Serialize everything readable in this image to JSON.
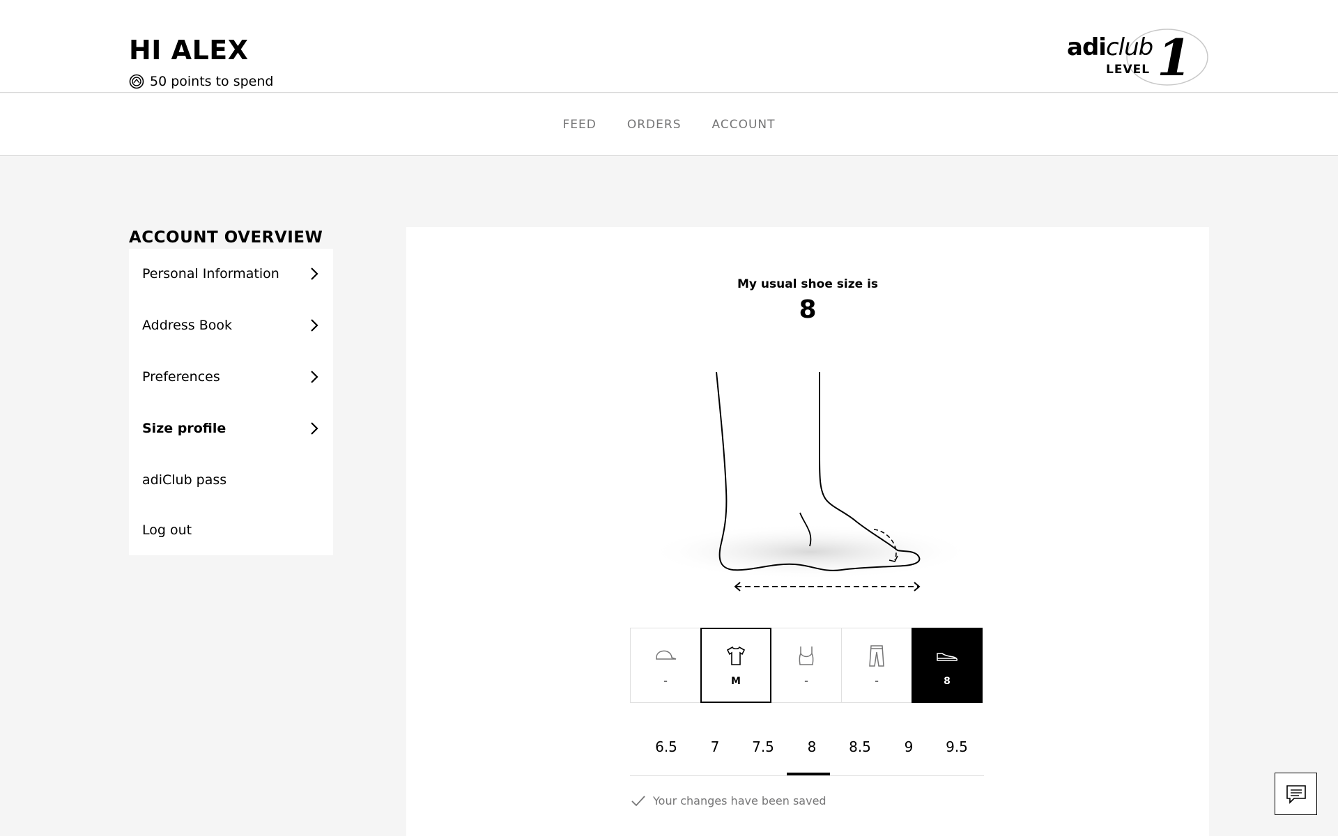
{
  "header": {
    "greeting": "HI ALEX",
    "points_text": "50 points to spend",
    "points_icon": "adiclub-coin-icon",
    "adiclub_brand_bold": "adi",
    "adiclub_brand_italic": "club",
    "adiclub_level_label": "LEVEL",
    "adiclub_level_number": "1"
  },
  "nav": {
    "items": [
      "FEED",
      "ORDERS",
      "ACCOUNT"
    ]
  },
  "sidebar": {
    "title": "ACCOUNT OVERVIEW",
    "items": [
      {
        "label": "Personal Information",
        "chevron": true,
        "active": false
      },
      {
        "label": "Address Book",
        "chevron": true,
        "active": false
      },
      {
        "label": "Preferences",
        "chevron": true,
        "active": false
      },
      {
        "label": "Size profile",
        "chevron": true,
        "active": true
      },
      {
        "label": "adiClub pass",
        "chevron": false,
        "active": false
      },
      {
        "label": "Log out",
        "chevron": false,
        "active": false
      }
    ]
  },
  "size_profile": {
    "caption": "My usual shoe size is",
    "value": "8",
    "categories": [
      {
        "icon": "cap-icon",
        "value": "-"
      },
      {
        "icon": "tshirt-icon",
        "value": "M"
      },
      {
        "icon": "sports-bra-icon",
        "value": "-"
      },
      {
        "icon": "pants-icon",
        "value": "-"
      },
      {
        "icon": "shoe-icon",
        "value": "8"
      }
    ],
    "sizes": [
      "6.5",
      "7",
      "7.5",
      "8",
      "8.5",
      "9",
      "9.5"
    ],
    "selected_size": "8",
    "saved_message": "Your changes have been saved"
  },
  "chat": {
    "icon": "chat-icon"
  }
}
